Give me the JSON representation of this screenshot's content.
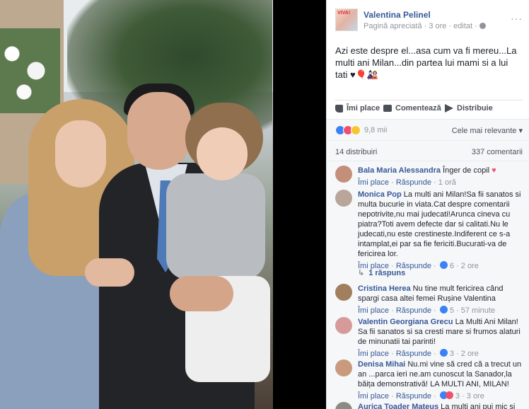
{
  "post": {
    "page_name": "Valentina Pelinel",
    "page_logo_text": "VIVA!",
    "meta": "Pagină apreciată · 3 ore · editat ·",
    "menu": "···",
    "text": "Azi este despre el...asa cum va fi mereu...La multi ani Milan...din partea lui mami si a lui tati ♥🎈🎎"
  },
  "actions": {
    "like": "Îmi place",
    "comment": "Comentează",
    "share": "Distribuie"
  },
  "reactions": {
    "count": "9,8 mii",
    "sort": "Cele mai relevante ▾"
  },
  "stats": {
    "shares": "14 distribuiri",
    "comments": "337 comentarii"
  },
  "comment_ui": {
    "like": "Îmi place",
    "reply": "Răspunde"
  },
  "comments": [
    {
      "author": "Bala Maria Alessandra",
      "text": "Înger de copil",
      "emoji": "♥",
      "time": "1 oră",
      "reactions": ""
    },
    {
      "author": "Monica Pop",
      "text": "La multi ani Milan!Sa fii sanatos si multa bucurie in viata.Cat despre comentarii nepotrivite,nu mai judecati!Arunca cineva cu piatra?Toti avem defecte dar si calitati.Nu le judecati,nu este crestineste.Indiferent ce s-a intamplat,ei par sa fie fericiti.Bucurati-va de fericirea lor.",
      "time": "2 ore",
      "reactions": "6",
      "replies": "1 răspuns"
    },
    {
      "author": "Cristina Herea",
      "text": "Nu tine mult fericirea când spargi casa altei femei Rușine Valentina",
      "time": "57 minute",
      "reactions": "5"
    },
    {
      "author": "Valentin Georgiana Grecu",
      "text": "La Multi Ani Milan! Sa fii sanatos si sa cresti mare si frumos alaturi de minunatii tai parinti!",
      "time": "2 ore",
      "reactions": "3"
    },
    {
      "author": "Denisa Mihai",
      "text": "Nu.mi vine să cred că a trecut un an ...parca ieri ne.am cunoscut la Sanador,la băița demonstrativă! LA MULTI ANI, MILAN!",
      "time": "3 ore",
      "reactions": "3"
    },
    {
      "author": "Aurica Toader Mateus",
      "text": "La multi ani pui mic si"
    }
  ],
  "colors": {
    "link": "#365899",
    "meta": "#90949c",
    "like_reaction": "#3b82f6",
    "love_reaction": "#f0506e"
  }
}
